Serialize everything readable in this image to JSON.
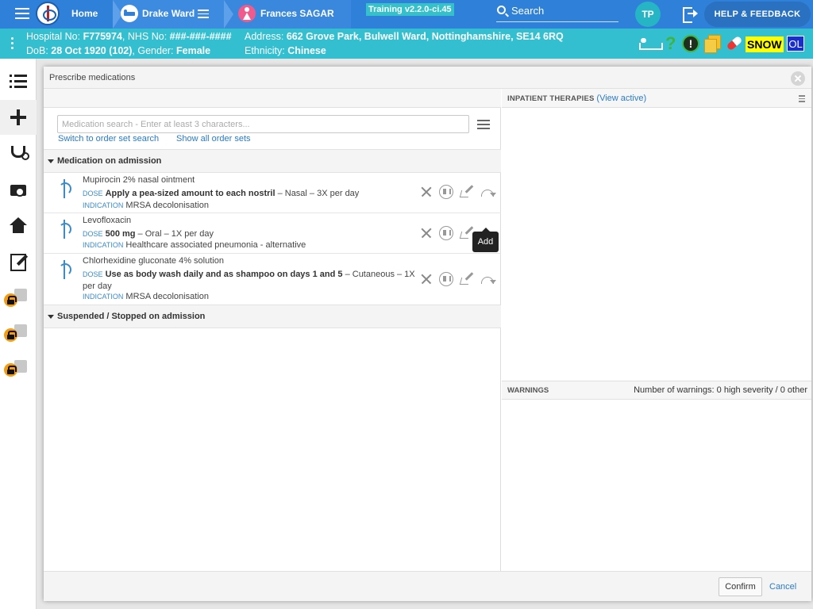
{
  "topbar": {
    "home": "Home",
    "ward": "Drake Ward",
    "patient": "Frances SAGAR",
    "training": "Training v2.2.0-ci.45",
    "search": "Search",
    "avatar": "TP",
    "help": "HELP & FEEDBACK"
  },
  "patient": {
    "hospital_label": "Hospital No: ",
    "hospital_no": "F775974",
    "nhs_label": ", NHS No: ",
    "nhs_no": "###-###-####",
    "dob_label": "DoB: ",
    "dob": "28 Oct 1920 (102)",
    "gender_label": ", Gender: ",
    "gender": "Female",
    "address_label": "Address: ",
    "address": "662 Grove Park, Bulwell Ward, Nottinghamshire, SE14 6RQ",
    "ethnicity_label": "Ethnicity: ",
    "ethnicity": "Chinese",
    "snow": "SNOW",
    "ol": "OL"
  },
  "modal": {
    "title": "Prescribe medications",
    "search_placeholder": "Medication search - Enter at least 3 characters...",
    "switch_link": "Switch to order set search",
    "show_all_link": "Show all order sets",
    "section_admission": "Medication on admission",
    "section_suspended": "Suspended / Stopped on admission",
    "dose_tag": "DOSE",
    "indication_tag": "INDICATION",
    "meds": [
      {
        "name": "Mupirocin 2% nasal ointment",
        "dose_bold": "Apply a pea-sized amount to each nostril",
        "dose_rest": " – Nasal – 3X per day",
        "indication": "MRSA decolonisation"
      },
      {
        "name": "Levofloxacin",
        "dose_bold": "500 mg",
        "dose_rest": " – Oral – 1X per day",
        "indication": "Healthcare associated pneumonia - alternative"
      },
      {
        "name": "Chlorhexidine gluconate 4% solution",
        "dose_bold": "Use as body wash daily and as shampoo on days 1 and 5",
        "dose_rest": " – Cutaneous – 1X per day",
        "indication": "MRSA decolonisation"
      }
    ],
    "tooltip": "Add",
    "inpatient_title": "INPATIENT THERAPIES",
    "view_active": "View active",
    "warnings_title": "WARNINGS",
    "warnings_count": "Number of warnings: 0 high severity / 0 other",
    "confirm": "Confirm",
    "cancel": "Cancel"
  }
}
